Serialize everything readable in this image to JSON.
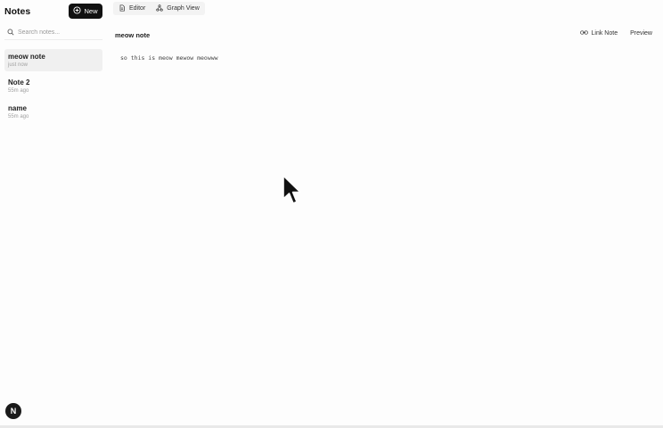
{
  "sidebar": {
    "title": "Notes",
    "new_label": "New",
    "search_placeholder": "Search notes...",
    "notes": [
      {
        "title": "meow note",
        "time": "just now",
        "active": true
      },
      {
        "title": "Note 2",
        "time": "55m ago",
        "active": false
      },
      {
        "title": "name",
        "time": "55m ago",
        "active": false
      }
    ]
  },
  "tabs": [
    {
      "label": "Editor",
      "icon": "file-icon"
    },
    {
      "label": "Graph View",
      "icon": "graph-icon"
    }
  ],
  "editor": {
    "note_title": "meow note",
    "link_note_label": "Link Note",
    "preview_label": "Preview",
    "content": "so this is meow mewow meowww"
  },
  "badge": {
    "letter": "N"
  }
}
